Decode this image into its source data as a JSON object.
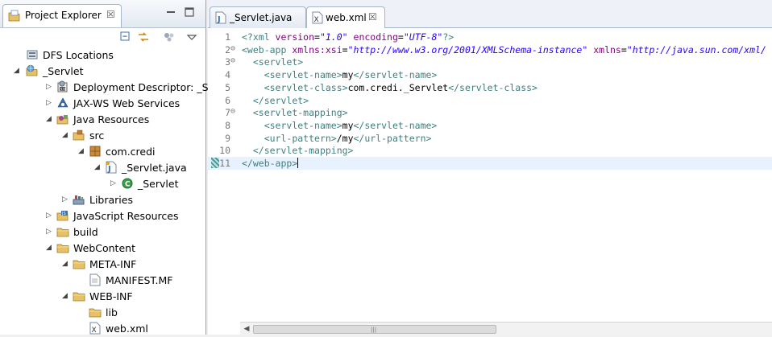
{
  "project_explorer": {
    "title": "Project Explorer",
    "close_glyph": "☒",
    "tree": [
      {
        "label": "DFS Locations",
        "icon": "dfs-icon",
        "indent": 0,
        "twisty": ""
      },
      {
        "label": "_Servlet",
        "icon": "web-project-icon",
        "indent": 0,
        "twisty": "expanded"
      },
      {
        "label": "Deployment Descriptor: _Servlet",
        "icon": "deployment-descriptor-icon",
        "indent": 1,
        "twisty": "collapsed"
      },
      {
        "label": "JAX-WS Web Services",
        "icon": "jaxws-icon",
        "indent": 1,
        "twisty": "collapsed"
      },
      {
        "label": "Java Resources",
        "icon": "java-resources-icon",
        "indent": 1,
        "twisty": "expanded"
      },
      {
        "label": "src",
        "icon": "source-folder-icon",
        "indent": 2,
        "twisty": "expanded"
      },
      {
        "label": "com.credi",
        "icon": "package-icon",
        "indent": 3,
        "twisty": "expanded"
      },
      {
        "label": "_Servlet.java",
        "icon": "java-file-icon",
        "indent": 4,
        "twisty": "expanded"
      },
      {
        "label": "_Servlet",
        "icon": "class-icon",
        "indent": 5,
        "twisty": "collapsed"
      },
      {
        "label": "Libraries",
        "icon": "libraries-icon",
        "indent": 2,
        "twisty": "collapsed"
      },
      {
        "label": "JavaScript Resources",
        "icon": "javascript-resources-icon",
        "indent": 1,
        "twisty": "collapsed"
      },
      {
        "label": "build",
        "icon": "folder-icon",
        "indent": 1,
        "twisty": "collapsed"
      },
      {
        "label": "WebContent",
        "icon": "folder-icon",
        "indent": 1,
        "twisty": "expanded"
      },
      {
        "label": "META-INF",
        "icon": "folder-icon",
        "indent": 2,
        "twisty": "expanded"
      },
      {
        "label": "MANIFEST.MF",
        "icon": "text-file-icon",
        "indent": 3,
        "twisty": ""
      },
      {
        "label": "WEB-INF",
        "icon": "folder-icon",
        "indent": 2,
        "twisty": "expanded"
      },
      {
        "label": "lib",
        "icon": "folder-icon",
        "indent": 3,
        "twisty": ""
      },
      {
        "label": "web.xml",
        "icon": "xml-file-icon",
        "indent": 3,
        "twisty": ""
      }
    ]
  },
  "editor": {
    "tabs": [
      {
        "label": "_Servlet.java",
        "active": false
      },
      {
        "label": "web.xml",
        "active": true,
        "close_glyph": "☒"
      }
    ],
    "lines": [
      {
        "n": "1",
        "fold": "",
        "parts": [
          [
            "tag",
            "<?xml "
          ],
          [
            "attr",
            "version"
          ],
          [
            "txtc",
            "="
          ],
          [
            "val",
            "\"1.0\""
          ],
          [
            "txtc",
            " "
          ],
          [
            "attr",
            "encoding"
          ],
          [
            "txtc",
            "="
          ],
          [
            "val",
            "\"UTF-8\""
          ],
          [
            "tag",
            "?>"
          ]
        ]
      },
      {
        "n": "2",
        "fold": "⊖",
        "parts": [
          [
            "tag",
            "<web-app "
          ],
          [
            "attr",
            "xmlns:xsi"
          ],
          [
            "txtc",
            "="
          ],
          [
            "val",
            "\"http://www.w3.org/2001/XMLSchema-instance\""
          ],
          [
            "txtc",
            " "
          ],
          [
            "attr",
            "xmlns"
          ],
          [
            "txtc",
            "="
          ],
          [
            "val",
            "\"http://java.sun.com/xml/"
          ]
        ]
      },
      {
        "n": "3",
        "fold": "⊖",
        "parts": [
          [
            "txtc",
            "  "
          ],
          [
            "tag",
            "<servlet>"
          ]
        ]
      },
      {
        "n": "4",
        "fold": "",
        "parts": [
          [
            "txtc",
            "    "
          ],
          [
            "tag",
            "<servlet-name>"
          ],
          [
            "txtc",
            "my"
          ],
          [
            "tag",
            "</servlet-name>"
          ]
        ]
      },
      {
        "n": "5",
        "fold": "",
        "parts": [
          [
            "txtc",
            "    "
          ],
          [
            "tag",
            "<servlet-class>"
          ],
          [
            "txtc",
            "com.credi._Servlet"
          ],
          [
            "tag",
            "</servlet-class>"
          ]
        ]
      },
      {
        "n": "6",
        "fold": "",
        "parts": [
          [
            "txtc",
            "  "
          ],
          [
            "tag",
            "</servlet>"
          ]
        ]
      },
      {
        "n": "7",
        "fold": "⊖",
        "parts": [
          [
            "txtc",
            "  "
          ],
          [
            "tag",
            "<servlet-mapping>"
          ]
        ]
      },
      {
        "n": "8",
        "fold": "",
        "parts": [
          [
            "txtc",
            "    "
          ],
          [
            "tag",
            "<servlet-name>"
          ],
          [
            "txtc",
            "my"
          ],
          [
            "tag",
            "</servlet-name>"
          ]
        ]
      },
      {
        "n": "9",
        "fold": "",
        "parts": [
          [
            "txtc",
            "    "
          ],
          [
            "tag",
            "<url-pattern>"
          ],
          [
            "txtc",
            "/my"
          ],
          [
            "tag",
            "</url-pattern>"
          ]
        ]
      },
      {
        "n": "10",
        "fold": "",
        "parts": [
          [
            "txtc",
            "  "
          ],
          [
            "tag",
            "</servlet-mapping>"
          ]
        ]
      },
      {
        "n": "11",
        "fold": "",
        "parts": [
          [
            "tag",
            "</web-app>"
          ]
        ]
      }
    ]
  },
  "scrollbar": {
    "grip": "|||"
  }
}
